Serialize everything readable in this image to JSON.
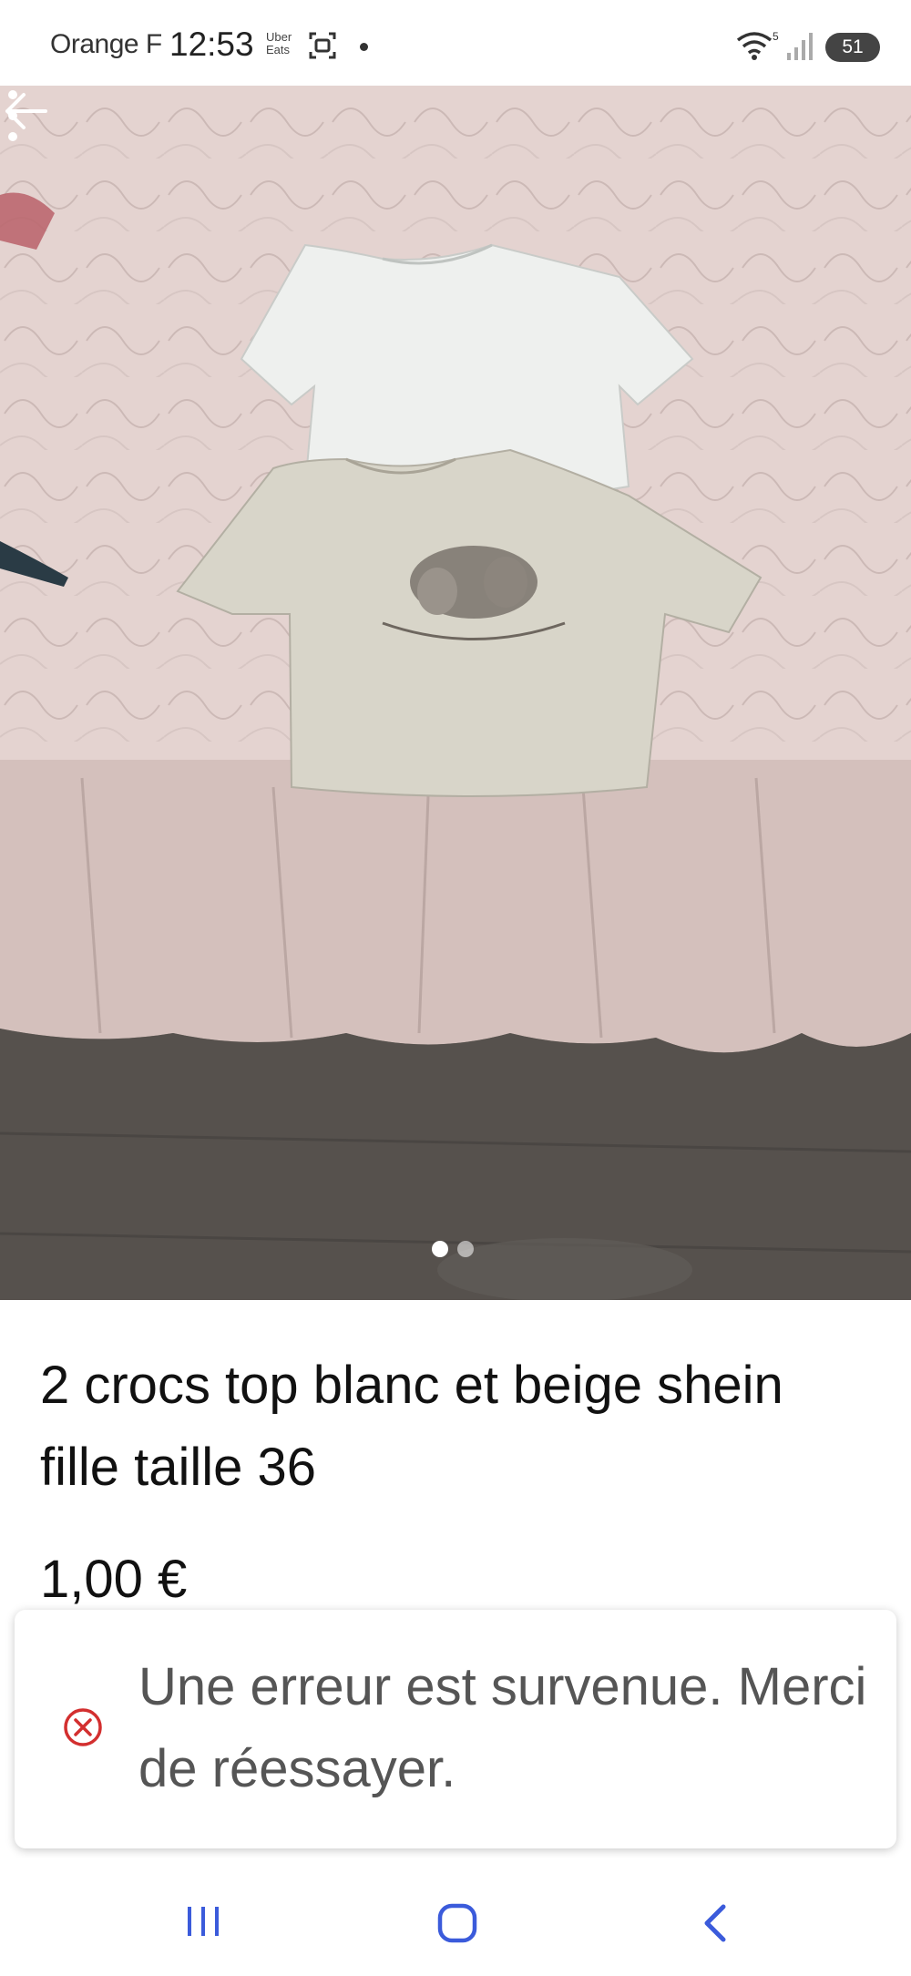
{
  "status_bar": {
    "carrier": "Orange F",
    "time": "12:53",
    "uber_eats": "Uber Eats",
    "wifi_label": "5",
    "battery": "51"
  },
  "listing": {
    "title": "2 crocs top blanc et beige shein fille taille 36",
    "price": "1,00 €",
    "image_count": 2,
    "image_index": 1
  },
  "toast": {
    "message": "Une erreur est survenue. Merci de réessayer."
  },
  "icons": {
    "back": "arrow-left-icon",
    "more": "more-vertical-icon",
    "error": "error-circle-icon",
    "nav_recents": "recents-icon",
    "nav_home": "home-icon",
    "nav_back": "chevron-left-icon"
  },
  "colors": {
    "error_red": "#d32f2f",
    "nav_blue": "#3b5bdb"
  }
}
